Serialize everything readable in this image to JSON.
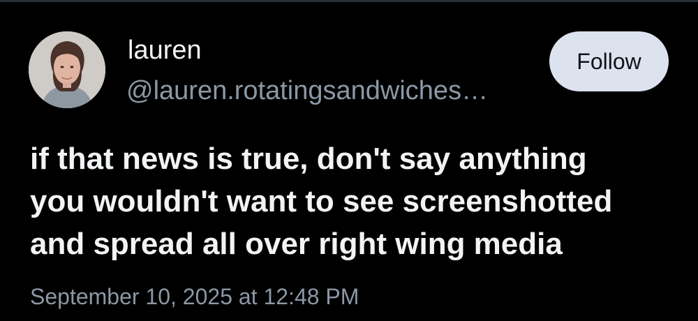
{
  "author": {
    "display_name": "lauren",
    "handle": "@lauren.rotatingsandwiches…",
    "avatar_description": "avatar"
  },
  "actions": {
    "follow_label": "Follow"
  },
  "post": {
    "text": "if that news is true, don't say anything\nyou wouldn't want to see screenshotted\nand spread all over right wing media",
    "timestamp": "September 10, 2025 at 12:48 PM"
  },
  "colors": {
    "background": "#000000",
    "primary_text": "#f1f3f5",
    "secondary_text": "#8b98a5",
    "follow_button_background": "#dce3ee",
    "follow_button_text": "#111418"
  }
}
